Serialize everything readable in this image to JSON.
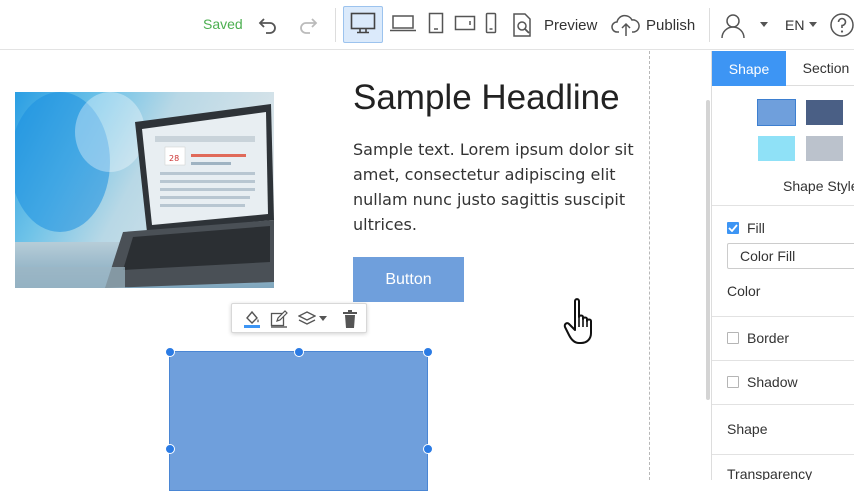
{
  "toolbar": {
    "status": "Saved",
    "preview_label": "Preview",
    "publish_label": "Publish",
    "language": "EN",
    "devices": [
      "desktop-icon",
      "laptop-icon",
      "tablet-portrait-icon",
      "tablet-landscape-icon",
      "mobile-icon"
    ],
    "active_device": "desktop"
  },
  "page": {
    "headline": "Sample Headline",
    "paragraph_lines": [
      "Sample text. Lorem ipsum dolor sit",
      "amet, consectetur adipiscing elit",
      "nullam nunc justo sagittis suscipit",
      "ultrices."
    ],
    "button_label": "Button"
  },
  "floating_toolbar": {
    "icons": [
      "fill-color-icon",
      "edit-icon",
      "layers-icon",
      "delete-icon"
    ]
  },
  "panel": {
    "tabs": [
      "Shape",
      "Section"
    ],
    "active_tab": "Shape",
    "swatches": [
      "#6f9fdc",
      "#4a5f85",
      "#8fe1f7",
      "#bbc2cc"
    ],
    "shape_styles_label": "Shape Style",
    "fill_label": "Fill",
    "fill_checked": true,
    "fill_type": "Color Fill",
    "color_label": "Color",
    "border_label": "Border",
    "border_checked": false,
    "shadow_label": "Shadow",
    "shadow_checked": false,
    "shape_label": "Shape",
    "transparency_label": "Transparency"
  },
  "colors": {
    "accent": "#3d95f4",
    "saved": "#4caf50",
    "shape_fill": "#6f9fdc"
  }
}
